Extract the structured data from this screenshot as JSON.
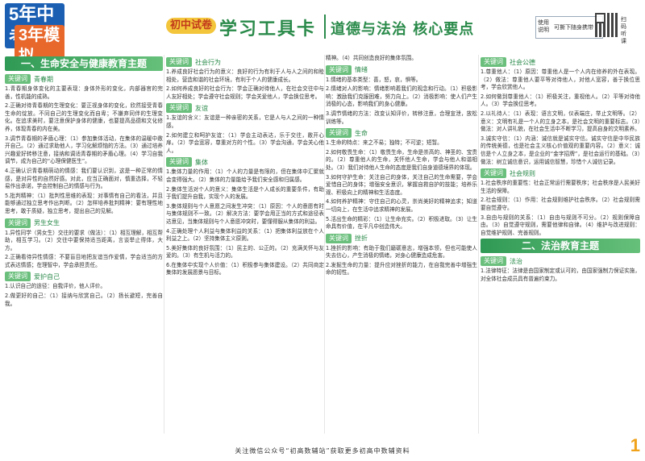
{
  "header": {
    "logo_line1": "5年中考",
    "logo_line2": "3年模拟",
    "badge": "初中试卷",
    "title": "学习工具卡",
    "subtitle": "道德与法治  核心要点",
    "box_a": "使用说明",
    "box_b": "可撕下随身携带",
    "qr_label": "扫码听课"
  },
  "col1": {
    "section1": "一、生命安全与健康教育主题",
    "kw_tag": "关键词",
    "kw1": "青春期",
    "p1": "1.青春期身体变化的主要表现：身体外形的变化，内部器官的完善，性机能的成熟。",
    "p2": "2.正确对待青春期的生理变化：要正视身体的变化，欣然接受青春生命的绽放。不同自己的生理变化而自卑；不嫌弃同伴的生理变化。在追求美时，要注意保护身体的健康，也要提高品德和文化修养，体现青春的内在美。",
    "p3": "3.调节青春期的矛盾心理：（1）参加集体活动，在集体的温暖中敞开自己。（2）通过求助他人，学习化解烦恼的方法。（3）通过培养兴趣爱好转移注意，接纳和调适青春期的矛盾心理。（4）学习自我调节，成为自己的“心理保健医生”。",
    "p4": "4.正确认识青春期萌动的情感：我们要认识到，这是一种正常的情感，是对异性的自然好感。对此，应当正确面对，慎重选择，不轻易作出承诺，学会控制自己的情感与行为。",
    "p5": "5.批判精神：（1）批判性思维的表现：对事情有自己的看法，并且能够通过独立思考作出判断。（2）怎样培养批判精神：要有理性地思考，敢于质疑，独立思考，提出自己的见解。",
    "kw2": "男生女生",
    "p6": "1.异性同学（男女生）交往的要求（做法）：（1）相互理解，相互帮助，相互学习。（2）交往中要保持适当距离，言谈举止得体，大方。",
    "p7": "2.正确看待异性情感：不要盲目地把友谊当作爱情，学会适当的方式表达情感；在理智中，学会承担责任。",
    "kw3": "爱护自己",
    "p8": "1.认识自己的途径：自我评价，他人评价。",
    "p9": "2.做更好的自己：（1）接纳与欣赏自己。（2）扬长避短，完善自我。"
  },
  "col2": {
    "kw_tag": "关键词",
    "kw1": "社会行为",
    "p1": "1.养成良好社会行为的意义：良好的行为有利于人与人之间的和睦相处，营造和谐的社会环境，有利于个人的健康成长。",
    "p2": "2.如何养成良好的社会行为：学会正确对待他人，在社会交往中与人友好相处；学会遵守社会规则；学会关爱他人，学会换位思考。",
    "kw2": "友谊",
    "p3": "1.友谊的含义：友谊是一种亲密的关系，它是人与人之间的一种情感。",
    "p4": "2.如何建立和呵护友谊：（1）学会主动表达，乐于交往，敞开心扉。（2）学会宽容，尊重对方的个性。（3）学会沟通，学会关心他人。",
    "kw3": "集体",
    "p5": "1.集体力量的作用：（1）个人的力量是有限的，但在集体中汇聚就会变得强大。（2）集体的力量能给予我们安全感和归属感。",
    "p6": "2.集体生活对个人的意义：集体生活是个人成长的重要条件，有助于我们提升自我，实现个人的发展。",
    "p7": "3.集体规则与个人意愿之间发生冲突：（1）原因：个人的意愿有时与集体规则不一致。（2）解决方法：要学会用正当的方式和途径表达意见，当集体规则与个人意愿冲突时，要懂得服从集体的利益。",
    "p8": "4.正确处理个人利益与集体利益的关系：（1）把集体利益放在个人利益之上。（2）坚持集体主义原则。",
    "p9": "5.美好集体的良好氛围：（1）民主的、公正的。（2）充满关怀与友爱的。（3）有生机与活力的。",
    "p10": "6.在集体中实现个人价值：（1）积极参与集体建设。（2）共同商定集体的发展愿景与目标。"
  },
  "col3": {
    "kw_tag": "关键词",
    "top": "精神。（4）共同创造良好的集体氛围。",
    "kw1": "情绪",
    "p1": "1.情绪的基本类型：喜，怒，哀，惧等。",
    "p2": "2.情绪对人的影响：情绪影响着我们的观念和行动。（1）积极影响：激励我们克服困难，努力向上。（2）消极影响：使人们产生消极的心态，影响我们的身心健康。",
    "p3": "3.调节情绪的方法：改变认知评价，转移注意，合理宣泄，放松训练等。",
    "kw2": "生命",
    "p4": "1.生命的特点：来之不易；独特；不可逆；短暂。",
    "p5": "2.如何敬畏生命：（1）敬畏生命，生命是崇高的、神圣的、宝贵的。（2）尊重他人的生命，关怀他人生命，学会与他人和谐相处。（3）我们对待他人生命的态度是我们自身道德境界的体现。",
    "p6": "3.如何守护生命：关注自己的身体，关注自己的生命需要，学会爱惜自己的身体；增强安全意识，掌握自救自护的技能；培养乐观、积极向上的精神和生活态度。",
    "p7": "4.如何养护精神：守住自己的心灵，崇尚美好的精神追求；知道一切向上，在生活中追求精神的发展。",
    "p8": "5.活出生命的精彩：（1）让生命充实。（2）积极进取。（3）让生命具有价值，在平凡中创造伟大。",
    "kw3": "挫折",
    "p9": "1.挫折的影响：有助于我们磨砺意志，增强本领，但也可能使人失去信心，产生消极的情绪，对身心健康造成危害。",
    "p10": "2.发掘生命的力量：提升应对挫折的能力，在自我完善中增强生命的韧性。"
  },
  "col4": {
    "kw_tag": "关键词",
    "kw1": "社会公德",
    "p1": "1.尊重他人：（1）原因：尊重他人是一个人内在修养的外在表现。（2）做法：尊重他人要平等对待他人，对他人宽容，善于换位思考，学会欣赏他人。",
    "p2": "2.如何做到尊重他人：（1）积极关注，重视他人。（2）平等对待他人。（3）学会换位思考。",
    "p3": "2.以礼待人：（1）表现：语言文明，仪表端庄，举止文明等。（2）意义：文明有礼是一个人的立身之本，是社会文明的重要标志。（3）做法：对人讲礼貌，在社会生活中不断学习，提高自身的文明素养。",
    "p4": "3.诚实守信：（1）内涵：诚信就是诚实守信。诚实守信是中华民族的传统美德，也是社会主义核心价值观的重要内容。（2）意义：诚信是个人立身之本，是企业的“金字招牌”，是社会运行的基础。（3）做法：树立诚信意识，运用诚信智慧，珍惜个人诚信记录。",
    "kw2": "社会规则",
    "p5": "1.社会秩序的重要性：社会正常运行需要秩序；社会秩序是人民美好生活的保障。",
    "p6": "2.社会规则：（1）作用：社会规则维护社会秩序。（2）社会规则需要自觉遵守。",
    "p7": "3.自由与规则的关系：（1）自由与规则不可分。（2）规则保障自由。（3）自觉遵守规则，需要他律和自律。（4）维护与改进规则：自觉维护规则、完善规则。",
    "section2": "二、法治教育主题",
    "kw3": "法治",
    "p8": "1.法律特征：法律是由国家制定或认可的，由国家强制力保证实施，对全体社会成员具有普遍约束力。"
  },
  "footer": "关注微信公众号“初高数辅站”获取更多初高中数辅资料",
  "page_number": "1"
}
